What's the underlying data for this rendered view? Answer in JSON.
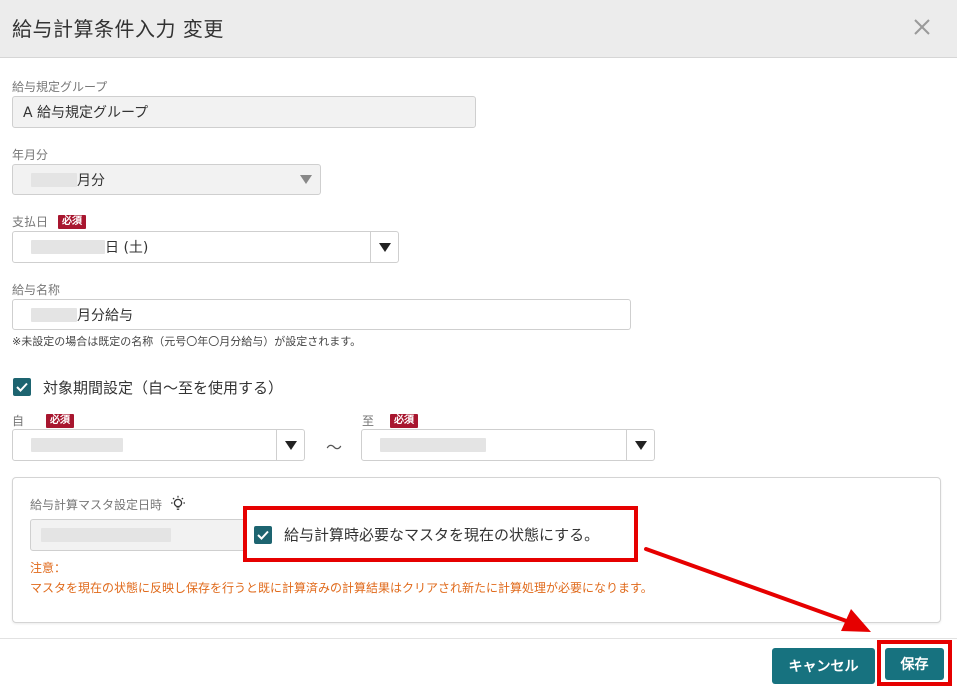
{
  "dialog": {
    "title": "給与計算条件入力 変更"
  },
  "group": {
    "label": "給与規定グループ",
    "value": "A 給与規定グループ"
  },
  "year_month": {
    "label": "年月分",
    "value_suffix": "月分"
  },
  "pay_date": {
    "label": "支払日",
    "required": "必須",
    "value_suffix": "日 (土)"
  },
  "salary_name": {
    "label": "給与名称",
    "value_suffix": "月分給与",
    "note": "※未設定の場合は既定の名称（元号〇年〇月分給与）が設定されます。"
  },
  "period": {
    "checkbox_label": "対象期間設定（自～至を使用する）",
    "from_label": "自",
    "to_label": "至",
    "required": "必須",
    "separator": "～"
  },
  "master": {
    "label": "給与計算マスタ設定日時",
    "checkbox_label": "給与計算時必要なマスタを現在の状態にする。",
    "warning_title": "注意：",
    "warning_text": "マスタを現在の状態に反映し保存を行うと既に計算済みの計算結果はクリアされ新たに計算処理が必要になります。"
  },
  "buttons": {
    "cancel": "キャンセル",
    "save": "保存"
  },
  "colors": {
    "accent": "#17727f",
    "required_badge": "#a8162f",
    "warning": "#e06a1b",
    "highlight": "#e60000"
  },
  "icons": {
    "close": "close-icon",
    "check": "check-icon",
    "dropdown": "chevron-down-icon",
    "info": "lightbulb-icon"
  }
}
